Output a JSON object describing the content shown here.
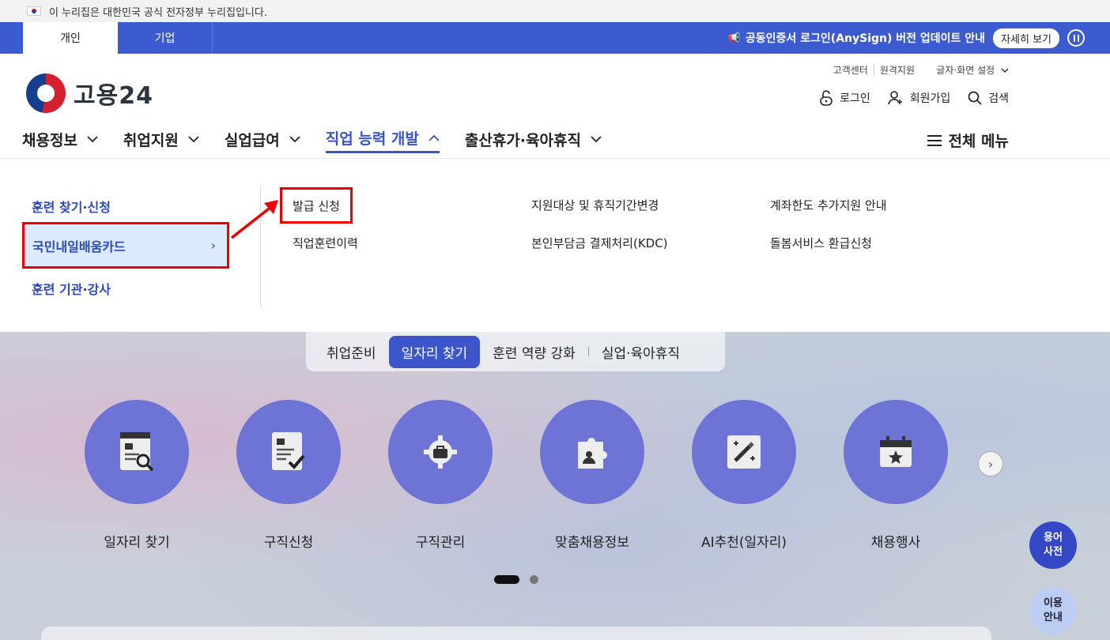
{
  "gov_banner": {
    "text": "이 누리집은 대한민국 공식 전자정부 누리집입니다."
  },
  "top_tabs": [
    {
      "label": "개인"
    },
    {
      "label": "기업"
    }
  ],
  "notice": {
    "text": "공동인증서 로그인(AnySign) 버전 업데이트 안내",
    "detail_label": "자세히 보기"
  },
  "header": {
    "logo_text": "고용24",
    "util_links": [
      "고객센터",
      "원격지원"
    ],
    "screen_setting": "글자·화면 설정",
    "actions": {
      "login": "로그인",
      "signup": "회원가입",
      "search": "검색"
    }
  },
  "gnb": {
    "items": [
      {
        "label": "채용정보"
      },
      {
        "label": "취업지원"
      },
      {
        "label": "실업급여"
      },
      {
        "label": "직업 능력 개발"
      },
      {
        "label": "출산휴가·육아휴직"
      }
    ],
    "all_menu": "전체 메뉴"
  },
  "dropdown": {
    "left": [
      "훈련 찾기·신청",
      "국민내일배움카드",
      "훈련 기관·강사"
    ],
    "links": {
      "issue": "발급 신청",
      "history": "직업훈련이력",
      "target_change": "지원대상 및 휴직기간변경",
      "kdc": "본인부담금 결제처리(KDC)",
      "limit_extra": "계좌한도 추가지원 안내",
      "care_refund": "돌봄서비스 환급신청"
    }
  },
  "hero": {
    "pills": [
      "취업준비",
      "일자리 찾기",
      "훈련 역량 강화",
      "실업·육아휴직"
    ],
    "services": [
      "일자리 찾기",
      "구직신청",
      "구직관리",
      "맞춤채용정보",
      "AI추천(일자리)",
      "채용행사"
    ]
  },
  "fabs": {
    "dict_1": "용어",
    "dict_2": "사전",
    "guide_1": "이용",
    "guide_2": "안내"
  },
  "colors": {
    "primary": "#3c5bd0",
    "service_circle": "#6e74d6",
    "highlight": "#e00000"
  }
}
